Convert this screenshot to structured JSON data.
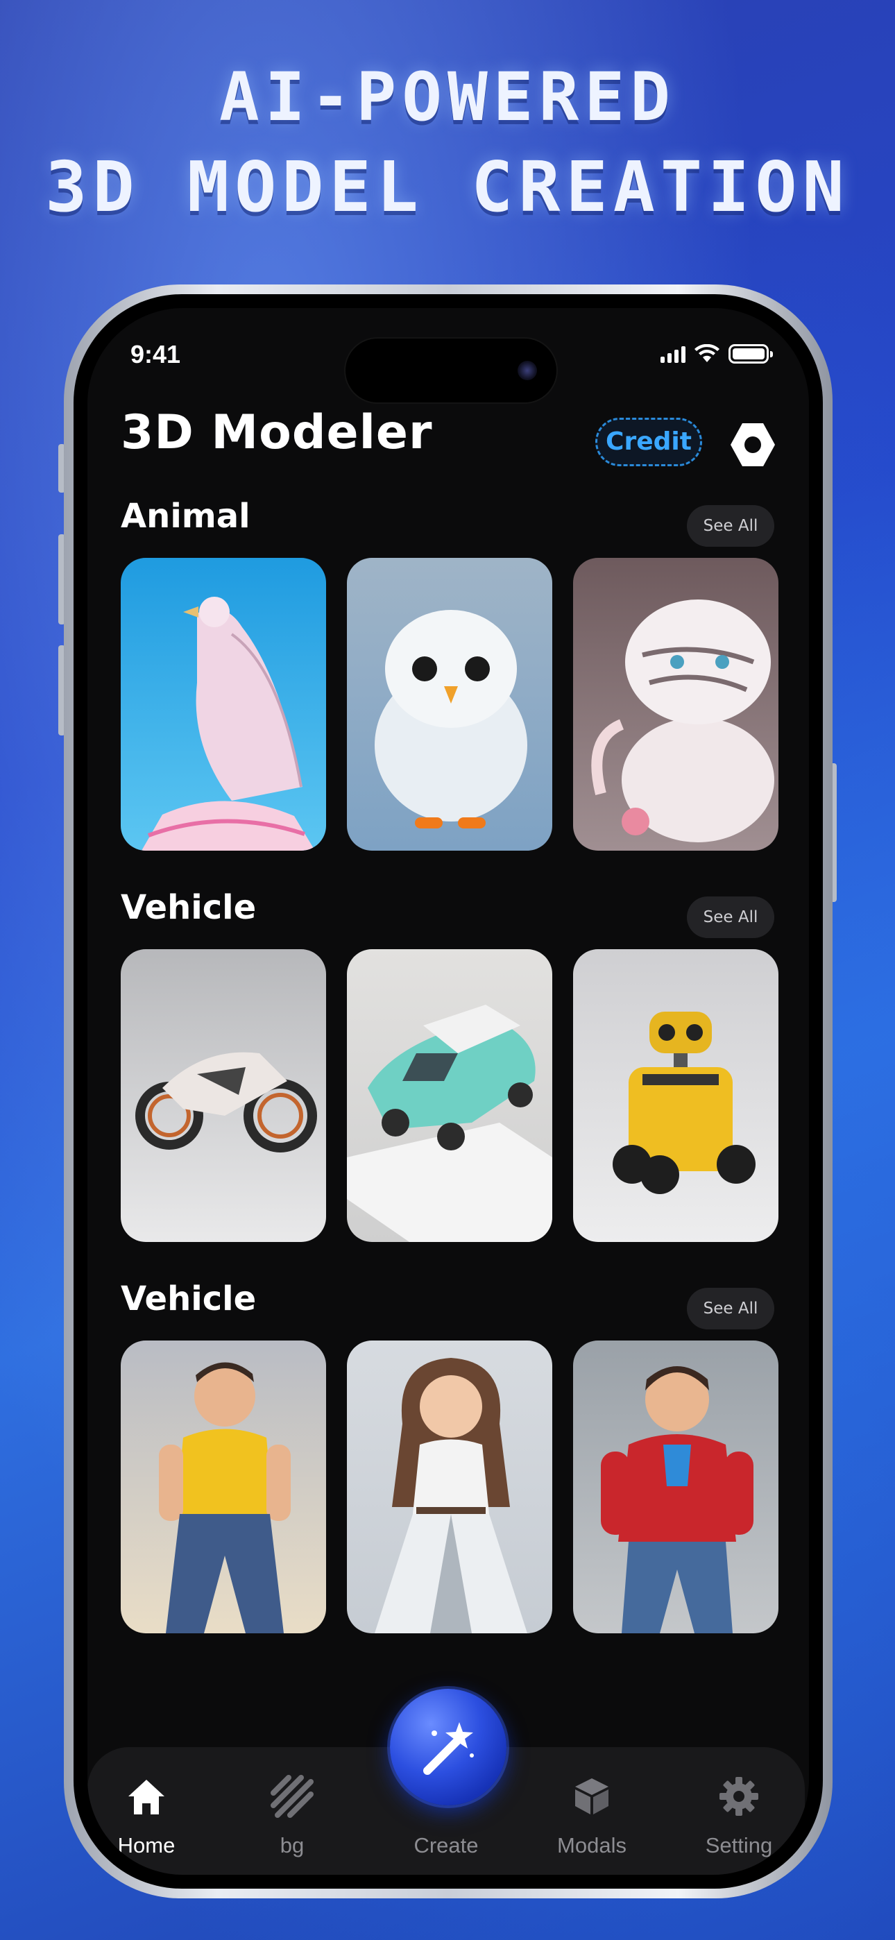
{
  "promo": {
    "line1": "AI-POWERED",
    "line2": "3D MODEL CREATION"
  },
  "status_bar": {
    "time": "9:41"
  },
  "header": {
    "title": "3D Modeler",
    "credit_label": "Credit",
    "settings_icon": "hexagon-settings-icon"
  },
  "sections": [
    {
      "title": "Animal",
      "see_all": "See All",
      "items": [
        "pink-eagle-model",
        "white-owl-model",
        "white-tiger-model"
      ]
    },
    {
      "title": "Vehicle",
      "see_all": "See All",
      "items": [
        "motorcycle-model",
        "teal-car-model",
        "yellow-robot-model"
      ]
    },
    {
      "title": "Vehicle",
      "see_all": "See All",
      "items": [
        "man-yellow-shirt-model",
        "woman-white-dress-model",
        "man-red-jacket-model"
      ]
    }
  ],
  "bottom_nav": {
    "items": [
      {
        "label": "Home",
        "icon": "home-icon",
        "active": true
      },
      {
        "label": "bg",
        "icon": "bg-stripes-icon",
        "active": false
      },
      {
        "label": "Create",
        "icon": "magic-wand-icon",
        "active": false
      },
      {
        "label": "Modals",
        "icon": "cube-icon",
        "active": false
      },
      {
        "label": "Setting",
        "icon": "gear-icon",
        "active": false
      }
    ]
  },
  "colors": {
    "accent_blue": "#3aa7ff",
    "screen_bg": "#0b0b0c",
    "nav_bg": "#19191b"
  }
}
